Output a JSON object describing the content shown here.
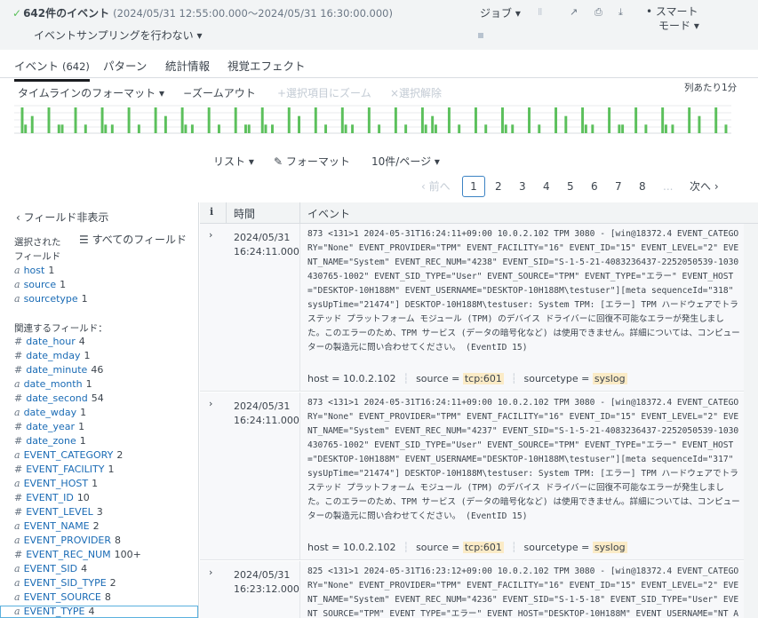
{
  "header": {
    "check_icon": "check-icon",
    "event_count": "642件のイベント",
    "time_range": "(2024/05/31 12:55:00.000～2024/05/31 16:30:00.000)",
    "sampling": "イベントサンプリングを行わない ▾",
    "job_menu": "ジョブ ▾",
    "pause_icon": "Ⅱ",
    "share_icon": "↗",
    "print_icon": "⎙",
    "export_icon": "⤓",
    "smart_mode_line1": "• スマート",
    "smart_mode_line2": "モード ▾"
  },
  "tabs": [
    {
      "label": "イベント",
      "count": "(642)"
    },
    {
      "label": "パターン"
    },
    {
      "label": "統計情報"
    },
    {
      "label": "視覚エフェクト"
    }
  ],
  "timeline": {
    "format_menu": "タイムラインのフォーマット ▾",
    "zoom_out": "−ズームアウト",
    "zoom_selection": "+選択項目にズーム",
    "deselect": "×選択解除",
    "per_column": "列あたり1分",
    "bar_color": "#5cc05c",
    "counts": [
      2,
      0,
      0,
      0,
      1,
      0,
      0,
      0,
      0,
      0,
      0,
      0,
      1,
      0,
      0,
      0,
      0,
      0,
      0,
      0,
      0,
      0,
      0,
      0,
      0,
      0,
      0,
      0,
      0,
      0,
      0,
      0,
      0,
      0,
      0,
      0,
      0,
      0,
      0,
      0,
      0,
      0,
      2,
      1,
      0,
      0,
      1,
      0,
      0,
      0,
      0,
      0,
      0,
      0,
      0,
      0,
      0,
      0,
      0,
      0,
      1,
      0,
      0,
      0,
      0,
      0,
      0,
      0,
      0,
      0,
      0,
      0,
      0,
      0,
      0,
      0,
      0,
      0,
      0,
      0,
      0,
      0,
      0,
      0,
      0,
      0,
      0,
      0,
      2,
      1,
      0,
      0,
      0,
      0,
      0,
      0,
      0,
      0,
      0,
      0,
      0,
      0,
      0,
      0,
      0,
      0,
      0,
      0,
      0,
      0,
      0,
      0,
      0,
      0,
      0,
      0,
      0,
      0,
      0,
      0,
      0,
      0,
      0,
      0,
      0,
      0,
      0,
      0,
      0,
      0,
      0,
      0,
      0,
      0,
      0,
      0,
      0,
      0,
      0,
      0,
      0,
      0,
      0,
      0,
      0,
      0,
      0,
      0,
      0,
      0,
      0,
      0,
      0,
      0,
      0,
      0,
      0,
      0,
      0,
      0,
      0,
      0,
      0,
      0,
      0,
      0,
      0,
      0,
      0,
      0,
      0,
      0,
      0,
      0,
      0,
      0,
      0,
      0,
      0,
      0,
      0,
      0,
      0,
      0,
      0,
      0,
      0,
      0,
      0,
      0,
      0,
      0,
      0,
      0,
      0,
      0,
      0,
      0,
      0,
      0,
      0,
      0,
      0,
      0,
      0,
      0,
      0,
      0,
      0,
      0,
      0,
      0
    ]
  },
  "results": {
    "list_menu": "リスト ▾",
    "format_menu": "✎ フォーマット",
    "per_page_menu": "10件/ページ ▾",
    "pager": {
      "prev": "‹ 前へ",
      "pages": [
        "1",
        "2",
        "3",
        "4",
        "5",
        "6",
        "7",
        "8"
      ],
      "ellipsis": "...",
      "next": "次へ ›"
    },
    "columns": {
      "info": "i",
      "time": "時間",
      "event": "イベント"
    }
  },
  "sidebar": {
    "hide_fields": "‹ フィールド非表示",
    "selected_label_1": "選択された",
    "selected_label_2": "フィールド",
    "all_fields": "☰ すべてのフィールド",
    "selected_fields": [
      {
        "type": "a",
        "name": "host",
        "count": "1"
      },
      {
        "type": "a",
        "name": "source",
        "count": "1"
      },
      {
        "type": "a",
        "name": "sourcetype",
        "count": "1"
      }
    ],
    "related_label": "関連するフィールド：",
    "related_fields": [
      {
        "type": "#",
        "name": "date_hour",
        "count": "4"
      },
      {
        "type": "#",
        "name": "date_mday",
        "count": "1"
      },
      {
        "type": "#",
        "name": "date_minute",
        "count": "46"
      },
      {
        "type": "a",
        "name": "date_month",
        "count": "1"
      },
      {
        "type": "#",
        "name": "date_second",
        "count": "54"
      },
      {
        "type": "a",
        "name": "date_wday",
        "count": "1"
      },
      {
        "type": "#",
        "name": "date_year",
        "count": "1"
      },
      {
        "type": "#",
        "name": "date_zone",
        "count": "1"
      },
      {
        "type": "a",
        "name": "EVENT_CATEGORY",
        "count": "2"
      },
      {
        "type": "#",
        "name": "EVENT_FACILITY",
        "count": "1"
      },
      {
        "type": "a",
        "name": "EVENT_HOST",
        "count": "1"
      },
      {
        "type": "#",
        "name": "EVENT_ID",
        "count": "10"
      },
      {
        "type": "#",
        "name": "EVENT_LEVEL",
        "count": "3"
      },
      {
        "type": "a",
        "name": "EVENT_NAME",
        "count": "2"
      },
      {
        "type": "a",
        "name": "EVENT_PROVIDER",
        "count": "8"
      },
      {
        "type": "#",
        "name": "EVENT_REC_NUM",
        "count": "100+"
      },
      {
        "type": "a",
        "name": "EVENT_SID",
        "count": "4"
      },
      {
        "type": "a",
        "name": "EVENT_SID_TYPE",
        "count": "2"
      },
      {
        "type": "a",
        "name": "EVENT_SOURCE",
        "count": "8"
      },
      {
        "type": "a",
        "name": "EVENT_TYPE",
        "count": "4"
      }
    ]
  },
  "events": [
    {
      "date": "2024/05/31",
      "time": "16:24:11.000",
      "raw": "873 <131>1 2024-05-31T16:24:11+09:00 10.0.2.102 TPM 3080 - [win@18372.4 EVENT_CATEGORY=\"None\" EVENT_PROVIDER=\"TPM\" EVENT_FACILITY=\"16\" EVENT_ID=\"15\" EVENT_LEVEL=\"2\" EVENT_NAME=\"System\" EVENT_REC_NUM=\"4238\" EVENT_SID=\"S-1-5-21-4083236437-2252050539-1030430765-1002\" EVENT_SID_TYPE=\"User\" EVENT_SOURCE=\"TPM\" EVENT_TYPE=\"エラー\" EVENT_HOST=\"DESKTOP-10H188M\" EVENT_USERNAME=\"DESKTOP-10H188M\\testuser\"][meta sequenceId=\"318\" sysUpTime=\"21474\"] DESKTOP-10H188M\\testuser: System TPM: [エラー] TPM ハードウェアでトラステッド プラットフォーム モジュール (TPM) のデバイス ドライバーに回復不可能なエラーが発生しました。このエラーのため、TPM サービス (データの暗号化など) は使用できません。詳細については、コンピューターの製造元に問い合わせてください。 (EventID 15)",
      "host_label": "host = ",
      "host": "10.0.2.102",
      "source_label": "source = ",
      "source": "tcp:601",
      "sourcetype_label": "sourcetype = ",
      "sourcetype": "syslog"
    },
    {
      "date": "2024/05/31",
      "time": "16:24:11.000",
      "raw": "873 <131>1 2024-05-31T16:24:11+09:00 10.0.2.102 TPM 3080 - [win@18372.4 EVENT_CATEGORY=\"None\" EVENT_PROVIDER=\"TPM\" EVENT_FACILITY=\"16\" EVENT_ID=\"15\" EVENT_LEVEL=\"2\" EVENT_NAME=\"System\" EVENT_REC_NUM=\"4237\" EVENT_SID=\"S-1-5-21-4083236437-2252050539-1030430765-1002\" EVENT_SID_TYPE=\"User\" EVENT_SOURCE=\"TPM\" EVENT_TYPE=\"エラー\" EVENT_HOST=\"DESKTOP-10H188M\" EVENT_USERNAME=\"DESKTOP-10H188M\\testuser\"][meta sequenceId=\"317\" sysUpTime=\"21474\"] DESKTOP-10H188M\\testuser: System TPM: [エラー] TPM ハードウェアでトラステッド プラットフォーム モジュール (TPM) のデバイス ドライバーに回復不可能なエラーが発生しました。このエラーのため、TPM サービス (データの暗号化など) は使用できません。詳細については、コンピューターの製造元に問い合わせてください。 (EventID 15)",
      "host_label": "host = ",
      "host": "10.0.2.102",
      "source_label": "source = ",
      "source": "tcp:601",
      "sourcetype_label": "sourcetype = ",
      "sourcetype": "syslog"
    },
    {
      "date": "2024/05/31",
      "time": "16:23:12.000",
      "raw": "825 <131>1 2024-05-31T16:23:12+09:00 10.0.2.102 TPM 3080 - [win@18372.4 EVENT_CATEGORY=\"None\" EVENT_PROVIDER=\"TPM\" EVENT_FACILITY=\"16\" EVENT_ID=\"15\" EVENT_LEVEL=\"2\" EVENT_NAME=\"System\" EVENT_REC_NUM=\"4236\" EVENT_SID=\"S-1-5-18\" EVENT_SID_TYPE=\"User\" EVENT_SOURCE=\"TPM\" EVENT_TYPE=\"エラー\" EVENT_HOST=\"DESKTOP-10H188M\" EVENT_USERNAME=\"NT AUTH"
    }
  ]
}
